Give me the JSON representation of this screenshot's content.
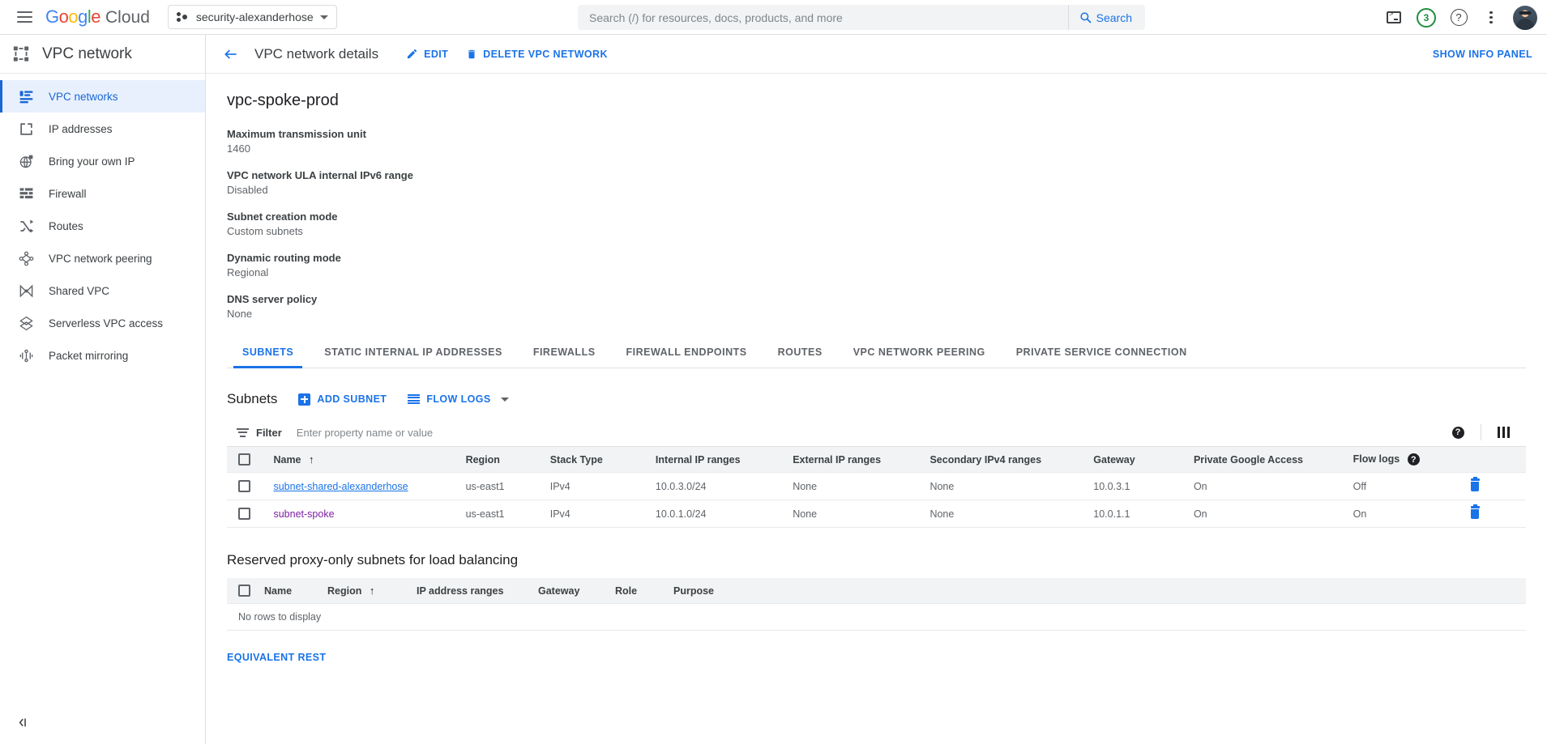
{
  "topbar": {
    "menu_icon": "hamburger-menu-icon",
    "brand": {
      "google": "Google",
      "cloud": "Cloud"
    },
    "project": {
      "name": "security-alexanderhose",
      "icon": "project-dots-icon"
    },
    "search": {
      "placeholder": "Search (/) for resources, docs, products, and more",
      "value": "",
      "button_label": "Search",
      "button_icon": "search-icon"
    },
    "icons": {
      "terminal": "cloud-shell-terminal-icon",
      "notifications_count": "3",
      "help": "help-question-icon",
      "more": "more-vertical-kebab-icon",
      "avatar": "user-avatar"
    }
  },
  "sidebar": {
    "title": "VPC network",
    "title_icon": "vpc-network-icon",
    "collapse_icon": "collapse-panel-icon",
    "items": [
      {
        "label": "VPC networks",
        "icon": "vpc-networks-icon",
        "active": true
      },
      {
        "label": "IP addresses",
        "icon": "ip-addresses-icon",
        "active": false
      },
      {
        "label": "Bring your own IP",
        "icon": "bring-your-own-ip-icon",
        "active": false
      },
      {
        "label": "Firewall",
        "icon": "firewall-icon",
        "active": false
      },
      {
        "label": "Routes",
        "icon": "routes-icon",
        "active": false
      },
      {
        "label": "VPC network peering",
        "icon": "vpc-peering-icon",
        "active": false
      },
      {
        "label": "Shared VPC",
        "icon": "shared-vpc-icon",
        "active": false
      },
      {
        "label": "Serverless VPC access",
        "icon": "serverless-vpc-access-icon",
        "active": false
      },
      {
        "label": "Packet mirroring",
        "icon": "packet-mirroring-icon",
        "active": false
      }
    ]
  },
  "page": {
    "back_icon": "back-arrow-icon",
    "title": "VPC network details",
    "actions": [
      {
        "label": "EDIT",
        "icon": "pencil-edit-icon"
      },
      {
        "label": "DELETE VPC NETWORK",
        "icon": "trash-delete-icon"
      }
    ],
    "show_info_panel": "SHOW INFO PANEL"
  },
  "details": {
    "resource_name": "vpc-spoke-prod",
    "properties": [
      {
        "key": "Maximum transmission unit",
        "value": "1460"
      },
      {
        "key": "VPC network ULA internal IPv6 range",
        "value": "Disabled"
      },
      {
        "key": "Subnet creation mode",
        "value": "Custom subnets"
      },
      {
        "key": "Dynamic routing mode",
        "value": "Regional"
      },
      {
        "key": "DNS server policy",
        "value": "None"
      }
    ]
  },
  "tabs": [
    {
      "label": "SUBNETS",
      "active": true
    },
    {
      "label": "STATIC INTERNAL IP ADDRESSES",
      "active": false
    },
    {
      "label": "FIREWALLS",
      "active": false
    },
    {
      "label": "FIREWALL ENDPOINTS",
      "active": false
    },
    {
      "label": "ROUTES",
      "active": false
    },
    {
      "label": "VPC NETWORK PEERING",
      "active": false
    },
    {
      "label": "PRIVATE SERVICE CONNECTION",
      "active": false
    }
  ],
  "subnets_section": {
    "title": "Subnets",
    "add_subnet_label": "ADD SUBNET",
    "flow_logs_label": "FLOW LOGS",
    "filter": {
      "label": "Filter",
      "placeholder": "Enter property name or value",
      "value": "",
      "icon": "filter-icon"
    },
    "toolbar_icons": {
      "help": "help-circle-icon",
      "columns": "column-display-options-icon"
    },
    "columns": [
      "Name",
      "Region",
      "Stack Type",
      "Internal IP ranges",
      "External IP ranges",
      "Secondary IPv4 ranges",
      "Gateway",
      "Private Google Access",
      "Flow logs"
    ],
    "sort_column": "Name",
    "sort_direction": "asc",
    "rows": [
      {
        "name": "subnet-shared-alexanderhose",
        "visited": false,
        "region": "us-east1",
        "stack_type": "IPv4",
        "internal_ip_ranges": "10.0.3.0/24",
        "external_ip_ranges": "None",
        "secondary_ipv4_ranges": "None",
        "gateway": "10.0.3.1",
        "private_google_access": "On",
        "flow_logs": "Off"
      },
      {
        "name": "subnet-spoke",
        "visited": true,
        "region": "us-east1",
        "stack_type": "IPv4",
        "internal_ip_ranges": "10.0.1.0/24",
        "external_ip_ranges": "None",
        "secondary_ipv4_ranges": "None",
        "gateway": "10.0.1.1",
        "private_google_access": "On",
        "flow_logs": "On"
      }
    ]
  },
  "proxy_section": {
    "title": "Reserved proxy-only subnets for load balancing",
    "columns": [
      "Name",
      "Region",
      "IP address ranges",
      "Gateway",
      "Role",
      "Purpose"
    ],
    "sort_column": "Region",
    "sort_direction": "asc",
    "empty_message": "No rows to display"
  },
  "footer": {
    "equivalent_rest": "EQUIVALENT REST"
  },
  "colors": {
    "accent_blue": "#1a73e8",
    "active_nav_bg": "#e8f0fe",
    "active_nav_text": "#1967d2",
    "visited_link": "#7b1fa2",
    "table_header_bg": "#f1f3f4",
    "notification_green": "#1e8e3e"
  }
}
